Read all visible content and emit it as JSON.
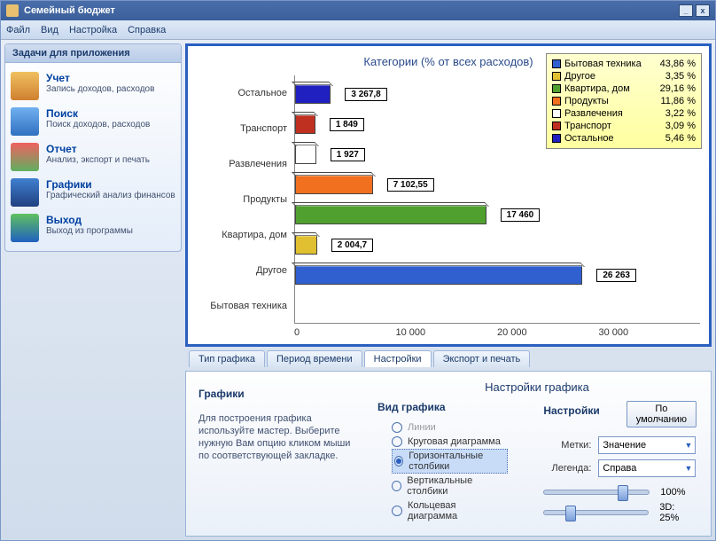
{
  "window": {
    "title": "Семейный бюджет"
  },
  "menu": {
    "file": "Файл",
    "view": "Вид",
    "settings": "Настройка",
    "help": "Справка"
  },
  "sidebar": {
    "header": "Задачи для приложения",
    "items": [
      {
        "title": "Учет",
        "desc": "Запись доходов, расходов",
        "iconColor": "linear-gradient(#f0c060,#d08030)"
      },
      {
        "title": "Поиск",
        "desc": "Поиск доходов, расходов",
        "iconColor": "linear-gradient(#70b0f0,#3070c0)"
      },
      {
        "title": "Отчет",
        "desc": "Анализ, экспорт и печать",
        "iconColor": "linear-gradient(#f06060,#60b060)"
      },
      {
        "title": "Графики",
        "desc": "Графический анализ финансов",
        "iconColor": "linear-gradient(#4080d0,#204080)"
      },
      {
        "title": "Выход",
        "desc": "Выход из программы",
        "iconColor": "linear-gradient(#60c060,#2060c0)"
      }
    ]
  },
  "chart_data": {
    "type": "bar",
    "orientation": "horizontal",
    "title": "Категории (% от всех расходов)",
    "xlim": [
      0,
      37000
    ],
    "xticks": [
      "0",
      "10 000",
      "20 000",
      "30 000"
    ],
    "categories": [
      "Остальное",
      "Транспорт",
      "Развлечения",
      "Продукты",
      "Квартира, дом",
      "Другое",
      "Бытовая техника"
    ],
    "values": [
      3267.8,
      1849,
      1927,
      7102.55,
      17460,
      2004.7,
      26263
    ],
    "value_labels": [
      "3 267,8",
      "1 849",
      "1 927",
      "7 102,55",
      "17 460",
      "2 004,7",
      "26 263"
    ],
    "colors": [
      "#2020c0",
      "#c03020",
      "#ffffff",
      "#f07020",
      "#50a030",
      "#e0c030",
      "#3060d0"
    ],
    "legend": [
      {
        "name": "Бытовая техника",
        "pct": "43,86 %",
        "color": "#3060d0"
      },
      {
        "name": "Другое",
        "pct": "3,35 %",
        "color": "#e0c030"
      },
      {
        "name": "Квартира, дом",
        "pct": "29,16 %",
        "color": "#50a030"
      },
      {
        "name": "Продукты",
        "pct": "11,86 %",
        "color": "#f07020"
      },
      {
        "name": "Развлечения",
        "pct": "3,22 %",
        "color": "#ffffff"
      },
      {
        "name": "Транспорт",
        "pct": "3,09 %",
        "color": "#c03020"
      },
      {
        "name": "Остальное",
        "pct": "5,46 %",
        "color": "#2020c0"
      }
    ]
  },
  "tabs": {
    "items": [
      "Тип графика",
      "Период времени",
      "Настройки",
      "Экспорт и печать"
    ],
    "active": 2
  },
  "help": {
    "title": "Графики",
    "text": "Для построения графика используйте мастер. Выберите нужную Вам опцию кликом мыши по соответствующей закладке."
  },
  "settings": {
    "title": "Настройки графика",
    "chartType": {
      "label": "Вид графика",
      "options": [
        "Линии",
        "Круговая диаграмма",
        "Горизонтальные столбики",
        "Вертикальные столбики",
        "Кольцевая диаграмма"
      ],
      "selected": 2,
      "disabled": [
        0
      ]
    },
    "controls": {
      "label": "Настройки",
      "defaultBtn": "По умолчанию",
      "labels": {
        "label": "Метки:",
        "value": "Значение"
      },
      "legend": {
        "label": "Легенда:",
        "value": "Справа"
      },
      "slider1": {
        "label": "100%",
        "pos": 70
      },
      "slider2": {
        "label": "3D: 25%",
        "pos": 20
      }
    }
  }
}
